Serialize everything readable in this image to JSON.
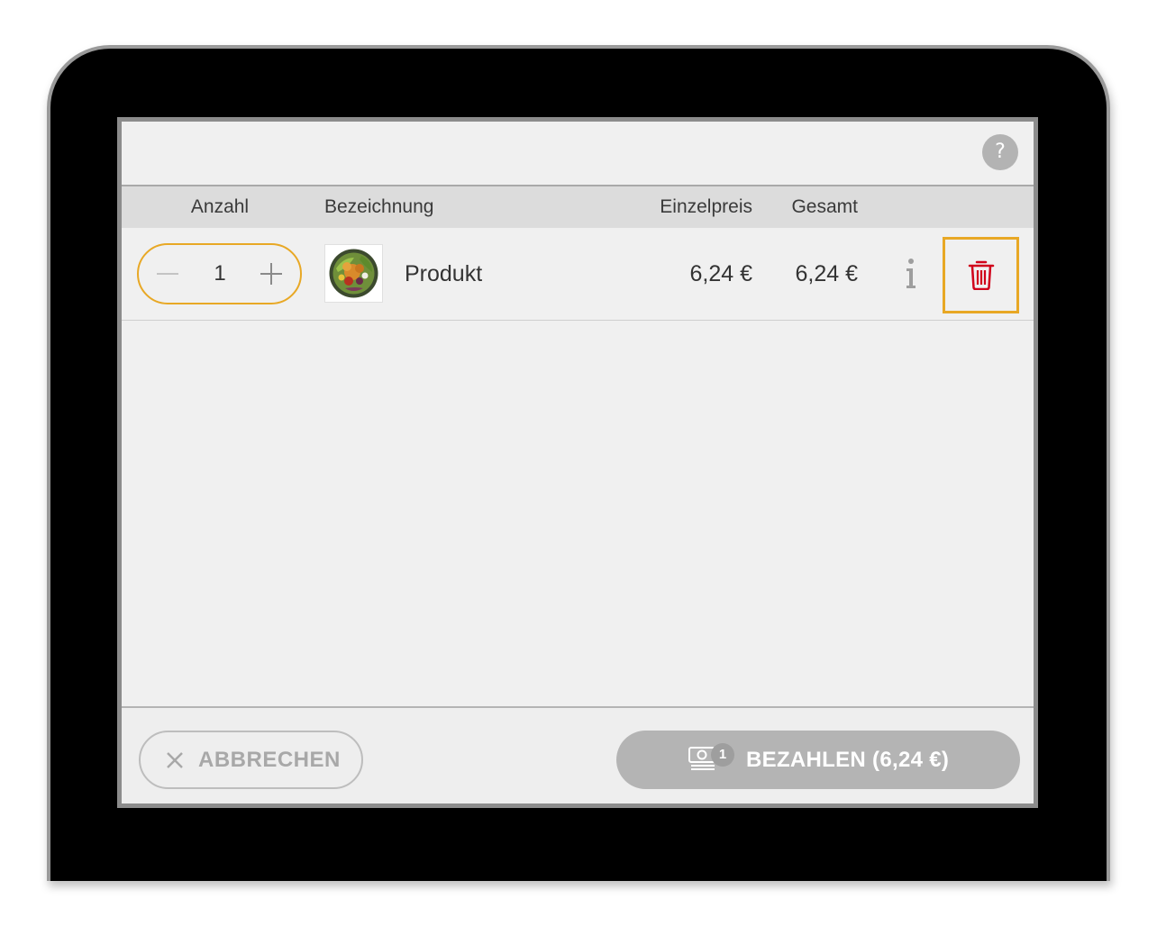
{
  "help": {
    "label": "?"
  },
  "table": {
    "headers": {
      "quantity": "Anzahl",
      "description": "Bezeichnung",
      "unit_price": "Einzelpreis",
      "total": "Gesamt"
    },
    "rows": [
      {
        "quantity": "1",
        "name": "Produkt",
        "unit_price": "6,24 €",
        "total": "6,24 €",
        "image": "salad-bowl"
      }
    ]
  },
  "footer": {
    "cancel_label": "ABBRECHEN",
    "pay_label": "BEZAHLEN (6,24 €)",
    "pay_badge": "1"
  },
  "icons": {
    "help": "question-mark-icon",
    "minus": "minus-icon",
    "plus": "plus-icon",
    "info": "info-icon",
    "delete": "trash-icon",
    "cancel": "close-icon",
    "pay": "cash-icon"
  },
  "colors": {
    "accent": "#e8a825",
    "delete": "#d0021b",
    "disabled_button": "#b4b4b4",
    "table_header": "#dcdcdc",
    "background": "#f0f0f0"
  }
}
